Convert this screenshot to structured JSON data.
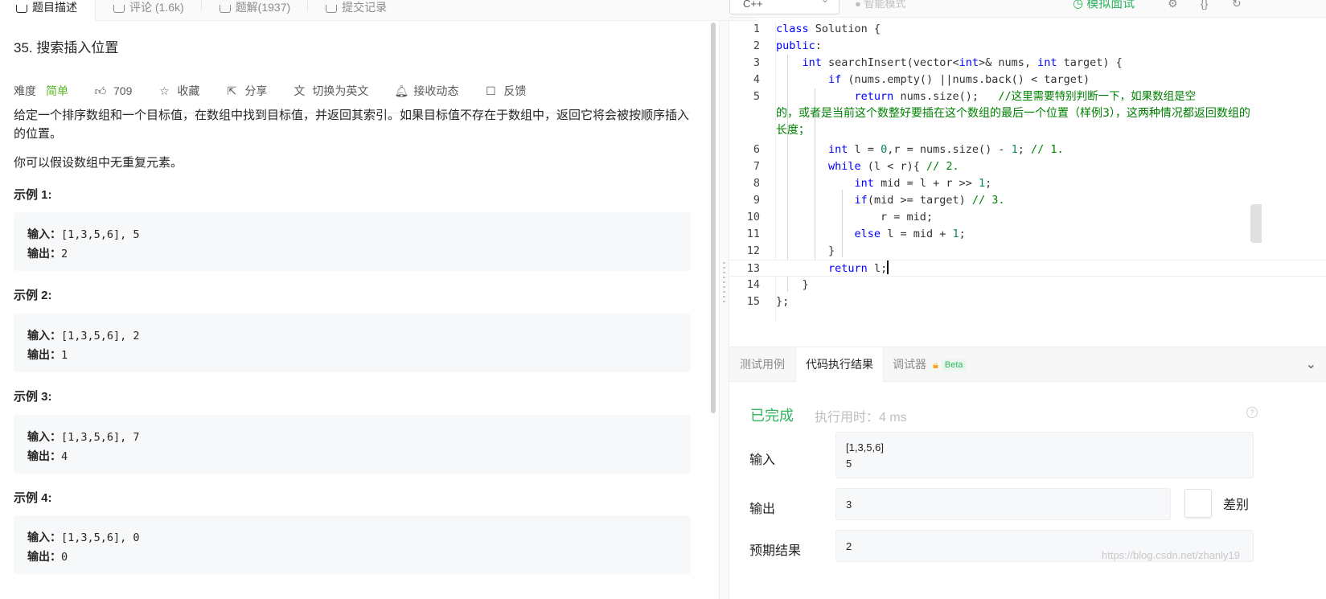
{
  "top_tabs": [
    {
      "label": "题目描述",
      "active": true
    },
    {
      "label": "评论 (1.6k)"
    },
    {
      "label": "题解(1937)"
    },
    {
      "label": "提交记录"
    }
  ],
  "editor_toolbar": {
    "language": "C++",
    "smart_mode": "智能模式",
    "mock_interview": "模拟面试"
  },
  "problem": {
    "title": "35. 搜索插入位置",
    "difficulty_label": "难度",
    "difficulty": "简单",
    "likes": "709",
    "actions": [
      "收藏",
      "分享",
      "切换为英文",
      "接收动态",
      "反馈"
    ],
    "description": "给定一个排序数组和一个目标值，在数组中找到目标值，并返回其索引。如果目标值不存在于数组中，返回它将会被按顺序插入的位置。",
    "note": "你可以假设数组中无重复元素。",
    "examples": [
      {
        "heading": "示例 1:",
        "input": "[1,3,5,6], 5",
        "output": "2"
      },
      {
        "heading": "示例 2:",
        "input": "[1,3,5,6], 2",
        "output": "1"
      },
      {
        "heading": "示例 3:",
        "input": "[1,3,5,6], 7",
        "output": "4"
      },
      {
        "heading": "示例 4:",
        "input": "[1,3,5,6], 0",
        "output": "0"
      }
    ],
    "input_key": "输入：",
    "output_key": "输出："
  },
  "code": {
    "line_numbers": [
      "1",
      "2",
      "3",
      "4",
      "5",
      "6",
      "7",
      "8",
      "9",
      "10",
      "11",
      "12",
      "13",
      "14",
      "15"
    ],
    "line5_comment_wrap": "的，或者是当前这个数整好要插在这个数组的最后一个位置（样例3），这两种情况都返回数组的长度；"
  },
  "console": {
    "tabs": [
      "测试用例",
      "代码执行结果",
      "调试器"
    ],
    "beta": "Beta",
    "status": "已完成",
    "runtime": "执行用时：4 ms",
    "input_label": "输入",
    "input_value": "[1,3,5,6]\n5",
    "output_label": "输出",
    "output_value": "3",
    "expected_label": "预期结果",
    "expected_value": "2",
    "diff_label": "差别"
  },
  "watermark": "https://blog.csdn.net/zhanly19"
}
